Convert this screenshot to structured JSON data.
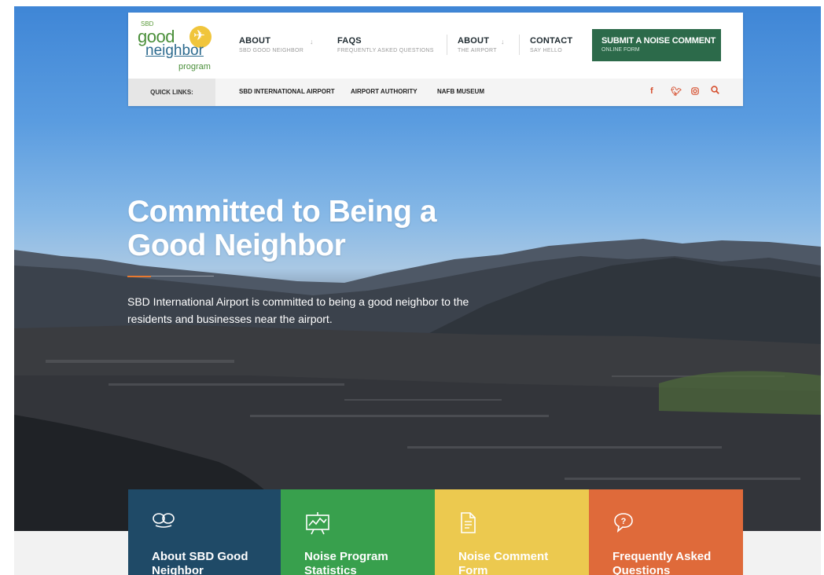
{
  "logo": {
    "sbd": "SBD",
    "good": "good",
    "neighbor": "neighbor",
    "program": "program"
  },
  "nav": [
    {
      "title": "ABOUT",
      "sub": "SBD GOOD NEIGHBOR"
    },
    {
      "title": "FAQS",
      "sub": "FREQUENTLY ASKED QUESTIONS"
    },
    {
      "title": "ABOUT",
      "sub": "THE AIRPORT"
    },
    {
      "title": "CONTACT",
      "sub": "SAY HELLO"
    }
  ],
  "cta": {
    "title": "SUBMIT A NOISE COMMENT",
    "sub": "ONLINE FORM"
  },
  "quick_links": {
    "label": "QUICK LINKS:",
    "links": [
      "SBD INTERNATIONAL AIRPORT",
      "AIRPORT AUTHORITY",
      "NAFB MUSEUM"
    ]
  },
  "social_icons": [
    "facebook-icon",
    "twitter-icon",
    "instagram-icon",
    "search-icon"
  ],
  "hero": {
    "title": "Committed to Being a Good Neighbor",
    "text": "SBD International Airport is committed to being a good neighbor to the residents and businesses near the airport."
  },
  "tiles": [
    {
      "label": "About SBD Good Neighbor",
      "icon": "eyes-icon",
      "color": "#1f4a67"
    },
    {
      "label": "Noise Program Statistics",
      "icon": "chart-board-icon",
      "color": "#38a04d"
    },
    {
      "label": "Noise Comment Form",
      "icon": "document-icon",
      "color": "#ecc94f"
    },
    {
      "label": "Frequently Asked Questions",
      "icon": "question-bubble-icon",
      "color": "#df6a3a"
    }
  ],
  "colors": {
    "accent": "#e8792f",
    "cta": "#2c6a4a",
    "social": "#d6502f"
  }
}
